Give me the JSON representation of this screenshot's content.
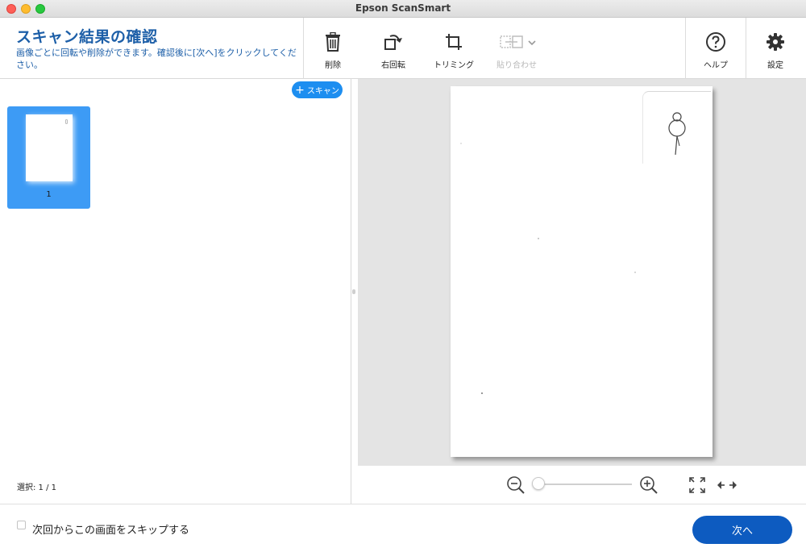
{
  "window": {
    "title": "Epson ScanSmart"
  },
  "header": {
    "title": "スキャン結果の確認",
    "description": "画像ごとに回転や削除ができます。確認後に[次へ]をクリックしてください。"
  },
  "toolbar": {
    "delete_label": "削除",
    "rotate_label": "右回転",
    "trim_label": "トリミング",
    "stitch_label": "貼り合わせ",
    "help_label": "ヘルプ",
    "settings_label": "設定"
  },
  "left_panel": {
    "scan_button_label": "スキャン",
    "thumbnails": [
      {
        "number": "1",
        "selected": true
      }
    ],
    "selection_text": "選択: 1 / 1"
  },
  "preview": {
    "zoom_level": 0
  },
  "footer": {
    "skip_label": "次回からこの画面をスキップする",
    "skip_checked": false,
    "next_label": "次へ"
  },
  "colors": {
    "accent": "#1d5fa8",
    "selection": "#3d9bf5",
    "primary_button": "#0d5bc0",
    "scan_button": "#1d8ef0"
  }
}
